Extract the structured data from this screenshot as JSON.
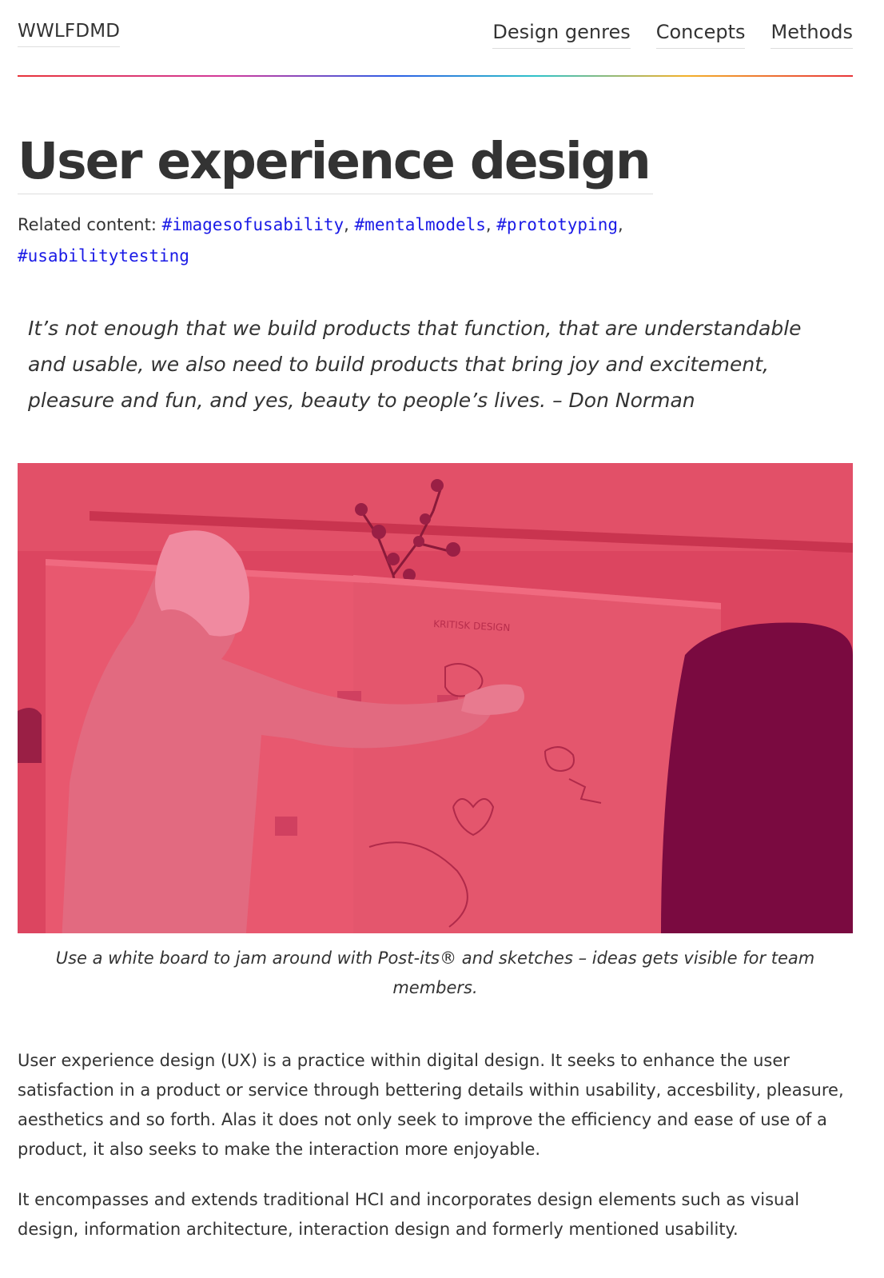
{
  "header": {
    "site_name": "WWLFDMD",
    "nav": [
      {
        "label": "Design genres"
      },
      {
        "label": "Concepts"
      },
      {
        "label": "Methods"
      }
    ]
  },
  "page": {
    "title": "User experience design",
    "related_label": "Related content: ",
    "tags": [
      "#imagesofusability",
      "#mentalmodels",
      "#prototyping",
      "#usabilitytesting"
    ],
    "quote": "It’s not enough that we build products that function, that are understandable and usable, we also need to build products that bring joy and excitement, pleasure and fun, and yes, beauty to people’s lives. – Don Norman",
    "image_caption": "Use a white board to jam around with Post-its® and sketches – ideas gets visible for team members.",
    "paragraphs": [
      "User experience design (UX) is a practice within digital design. It seeks to enhance the user satisfaction in a product or service through bettering details within usability, accesbility, pleasure, aesthetics and so forth. Alas it does not only seek to improve the efficiency and ease of use of a product, it also seeks to make the interaction more enjoyable.",
      "It encompasses and extends traditional HCI and incorporates design elements such as visual design, information architecture, interaction design and formerly mentioned usability."
    ],
    "whiteboard_text": "KRITISK DESIGN"
  },
  "colors": {
    "text": "#333333",
    "tag_link": "#1a1ae6",
    "photo_tint": "#dc4560",
    "photo_dark": "#7a0a40"
  }
}
